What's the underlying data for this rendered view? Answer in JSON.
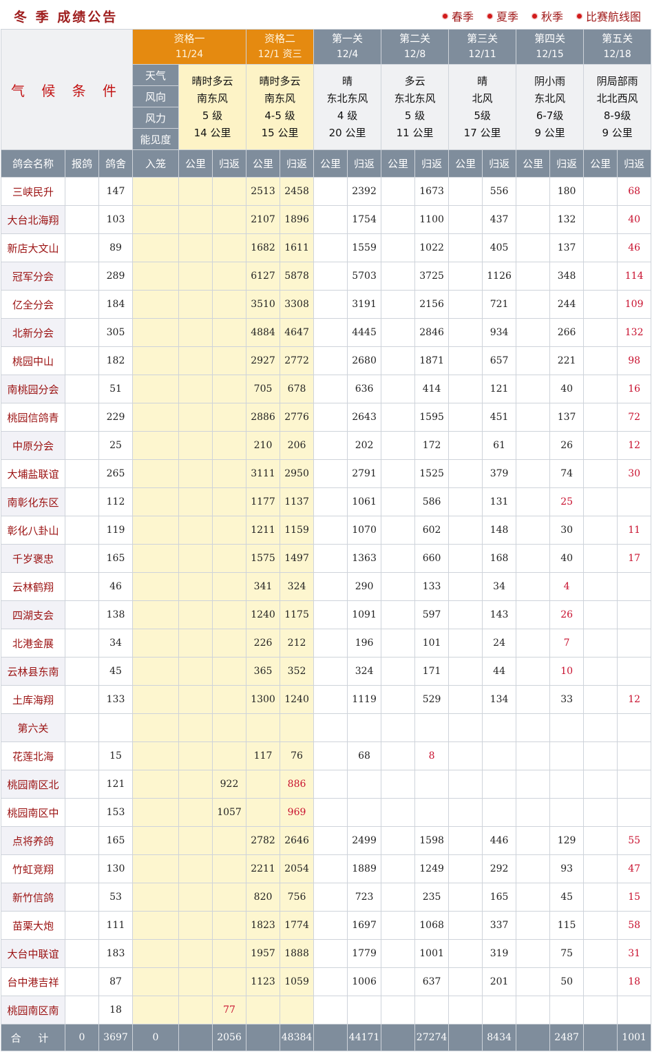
{
  "header": {
    "title": "冬 季 成绩公告",
    "links": [
      "春季",
      "夏季",
      "秋季",
      "比赛航线图"
    ]
  },
  "climate_label": "气 候 条 件",
  "weather_labels": [
    "天气",
    "风向",
    "风力",
    "能见度"
  ],
  "stages": [
    {
      "name": "资格一",
      "date": "11/24",
      "weather": [
        "晴时多云",
        "南东风",
        "5 级",
        "14 公里"
      ]
    },
    {
      "name": "资格二",
      "date": "12/1 资三",
      "weather": [
        "晴时多云",
        "南东风",
        "4-5 级",
        "15 公里"
      ]
    },
    {
      "name": "第一关",
      "date": "12/4",
      "weather": [
        "晴",
        "东北东风",
        "4 级",
        "20 公里"
      ]
    },
    {
      "name": "第二关",
      "date": "12/8",
      "weather": [
        "多云",
        "东北东风",
        "5 级",
        "11 公里"
      ]
    },
    {
      "name": "第三关",
      "date": "12/11",
      "weather": [
        "晴",
        "北风",
        "5级",
        "17 公里"
      ]
    },
    {
      "name": "第四关",
      "date": "12/15",
      "weather": [
        "阴小雨",
        "东北风",
        "6-7级",
        "9 公里"
      ]
    },
    {
      "name": "第五关",
      "date": "12/18",
      "weather": [
        "阴局部雨",
        "北北西风",
        "8-9级",
        "9 公里"
      ]
    }
  ],
  "columns": [
    "鸽会名称",
    "报鸽",
    "鸽舍",
    "入笼",
    "公里",
    "归返",
    "公里",
    "归返",
    "公里",
    "归返",
    "公里",
    "归返",
    "公里",
    "归返",
    "公里",
    "归返",
    "公里",
    "归返"
  ],
  "rows": [
    [
      "三峡民升",
      "",
      "147",
      "",
      "",
      "",
      "2513",
      "2458",
      "",
      "2392",
      "",
      "1673",
      "",
      "556",
      "",
      "180",
      "",
      "68"
    ],
    [
      "大台北海翔",
      "",
      "103",
      "",
      "",
      "",
      "2107",
      "1896",
      "",
      "1754",
      "",
      "1100",
      "",
      "437",
      "",
      "132",
      "",
      "40"
    ],
    [
      "新店大文山",
      "",
      "89",
      "",
      "",
      "",
      "1682",
      "1611",
      "",
      "1559",
      "",
      "1022",
      "",
      "405",
      "",
      "137",
      "",
      "46"
    ],
    [
      "冠军分会",
      "",
      "289",
      "",
      "",
      "",
      "6127",
      "5878",
      "",
      "5703",
      "",
      "3725",
      "",
      "1126",
      "",
      "348",
      "",
      "114"
    ],
    [
      "亿全分会",
      "",
      "184",
      "",
      "",
      "",
      "3510",
      "3308",
      "",
      "3191",
      "",
      "2156",
      "",
      "721",
      "",
      "244",
      "",
      "109"
    ],
    [
      "北新分会",
      "",
      "305",
      "",
      "",
      "",
      "4884",
      "4647",
      "",
      "4445",
      "",
      "2846",
      "",
      "934",
      "",
      "266",
      "",
      "132"
    ],
    [
      "桃园中山",
      "",
      "182",
      "",
      "",
      "",
      "2927",
      "2772",
      "",
      "2680",
      "",
      "1871",
      "",
      "657",
      "",
      "221",
      "",
      "98"
    ],
    [
      "南桃园分会",
      "",
      "51",
      "",
      "",
      "",
      "705",
      "678",
      "",
      "636",
      "",
      "414",
      "",
      "121",
      "",
      "40",
      "",
      "16"
    ],
    [
      "桃园信鸽青",
      "",
      "229",
      "",
      "",
      "",
      "2886",
      "2776",
      "",
      "2643",
      "",
      "1595",
      "",
      "451",
      "",
      "137",
      "",
      "72"
    ],
    [
      "中原分会",
      "",
      "25",
      "",
      "",
      "",
      "210",
      "206",
      "",
      "202",
      "",
      "172",
      "",
      "61",
      "",
      "26",
      "",
      "12"
    ],
    [
      "大埔盐联谊",
      "",
      "265",
      "",
      "",
      "",
      "3111",
      "2950",
      "",
      "2791",
      "",
      "1525",
      "",
      "379",
      "",
      "74",
      "",
      "30"
    ],
    [
      "南彰化东区",
      "",
      "112",
      "",
      "",
      "",
      "1177",
      "1137",
      "",
      "1061",
      "",
      "586",
      "",
      "131",
      "",
      "25",
      "",
      ""
    ],
    [
      "彰化八卦山",
      "",
      "119",
      "",
      "",
      "",
      "1211",
      "1159",
      "",
      "1070",
      "",
      "602",
      "",
      "148",
      "",
      "30",
      "",
      "11"
    ],
    [
      "千岁褒忠",
      "",
      "165",
      "",
      "",
      "",
      "1575",
      "1497",
      "",
      "1363",
      "",
      "660",
      "",
      "168",
      "",
      "40",
      "",
      "17"
    ],
    [
      "云林鹤翔",
      "",
      "46",
      "",
      "",
      "",
      "341",
      "324",
      "",
      "290",
      "",
      "133",
      "",
      "34",
      "",
      "4",
      "",
      ""
    ],
    [
      "四湖支会",
      "",
      "138",
      "",
      "",
      "",
      "1240",
      "1175",
      "",
      "1091",
      "",
      "597",
      "",
      "143",
      "",
      "26",
      "",
      ""
    ],
    [
      "北港金展",
      "",
      "34",
      "",
      "",
      "",
      "226",
      "212",
      "",
      "196",
      "",
      "101",
      "",
      "24",
      "",
      "7",
      "",
      ""
    ],
    [
      "云林县东南",
      "",
      "45",
      "",
      "",
      "",
      "365",
      "352",
      "",
      "324",
      "",
      "171",
      "",
      "44",
      "",
      "10",
      "",
      ""
    ],
    [
      "土库海翔",
      "",
      "133",
      "",
      "",
      "",
      "1300",
      "1240",
      "",
      "1119",
      "",
      "529",
      "",
      "134",
      "",
      "33",
      "",
      "12"
    ],
    [
      "第六关",
      "",
      "",
      "",
      "",
      "",
      "",
      "",
      "",
      "",
      "",
      "",
      "",
      "",
      "",
      "",
      "",
      ""
    ],
    [
      "花莲北海",
      "",
      "15",
      "",
      "",
      "",
      "117",
      "76",
      "",
      "68",
      "",
      "8",
      "",
      "",
      "",
      "",
      "",
      ""
    ],
    [
      "桃园南区北",
      "",
      "121",
      "",
      "",
      "922",
      "",
      "886",
      "",
      "",
      "",
      "",
      "",
      "",
      "",
      "",
      "",
      ""
    ],
    [
      "桃园南区中",
      "",
      "153",
      "",
      "",
      "1057",
      "",
      "969",
      "",
      "",
      "",
      "",
      "",
      "",
      "",
      "",
      "",
      ""
    ],
    [
      "点将养鸽",
      "",
      "165",
      "",
      "",
      "",
      "2782",
      "2646",
      "",
      "2499",
      "",
      "1598",
      "",
      "446",
      "",
      "129",
      "",
      "55"
    ],
    [
      "竹虹竞翔",
      "",
      "130",
      "",
      "",
      "",
      "2211",
      "2054",
      "",
      "1889",
      "",
      "1249",
      "",
      "292",
      "",
      "93",
      "",
      "47"
    ],
    [
      "新竹信鸽",
      "",
      "53",
      "",
      "",
      "",
      "820",
      "756",
      "",
      "723",
      "",
      "235",
      "",
      "165",
      "",
      "45",
      "",
      "15"
    ],
    [
      "苗栗大炮",
      "",
      "111",
      "",
      "",
      "",
      "1823",
      "1774",
      "",
      "1697",
      "",
      "1068",
      "",
      "337",
      "",
      "115",
      "",
      "58"
    ],
    [
      "大台中联谊",
      "",
      "183",
      "",
      "",
      "",
      "1957",
      "1888",
      "",
      "1779",
      "",
      "1001",
      "",
      "319",
      "",
      "75",
      "",
      "31"
    ],
    [
      "台中港吉祥",
      "",
      "87",
      "",
      "",
      "",
      "1123",
      "1059",
      "",
      "1006",
      "",
      "637",
      "",
      "201",
      "",
      "50",
      "",
      "18"
    ],
    [
      "桃园南区南",
      "",
      "18",
      "",
      "",
      "77",
      "",
      "",
      "",
      "",
      "",
      "",
      "",
      "",
      "",
      "",
      "",
      ""
    ]
  ],
  "totals": [
    "合 计",
    "0",
    "3697",
    "0",
    "",
    "2056",
    "",
    "48384",
    "",
    "44171",
    "",
    "27274",
    "",
    "8434",
    "",
    "2487",
    "",
    "1001"
  ],
  "colors": {
    "accent_orange": "#e58a10",
    "header_gray": "#7f8d9c",
    "qualifier_yellow": "#fdf6cf",
    "text_red": "#c8102e",
    "name_red": "#9b1212"
  }
}
